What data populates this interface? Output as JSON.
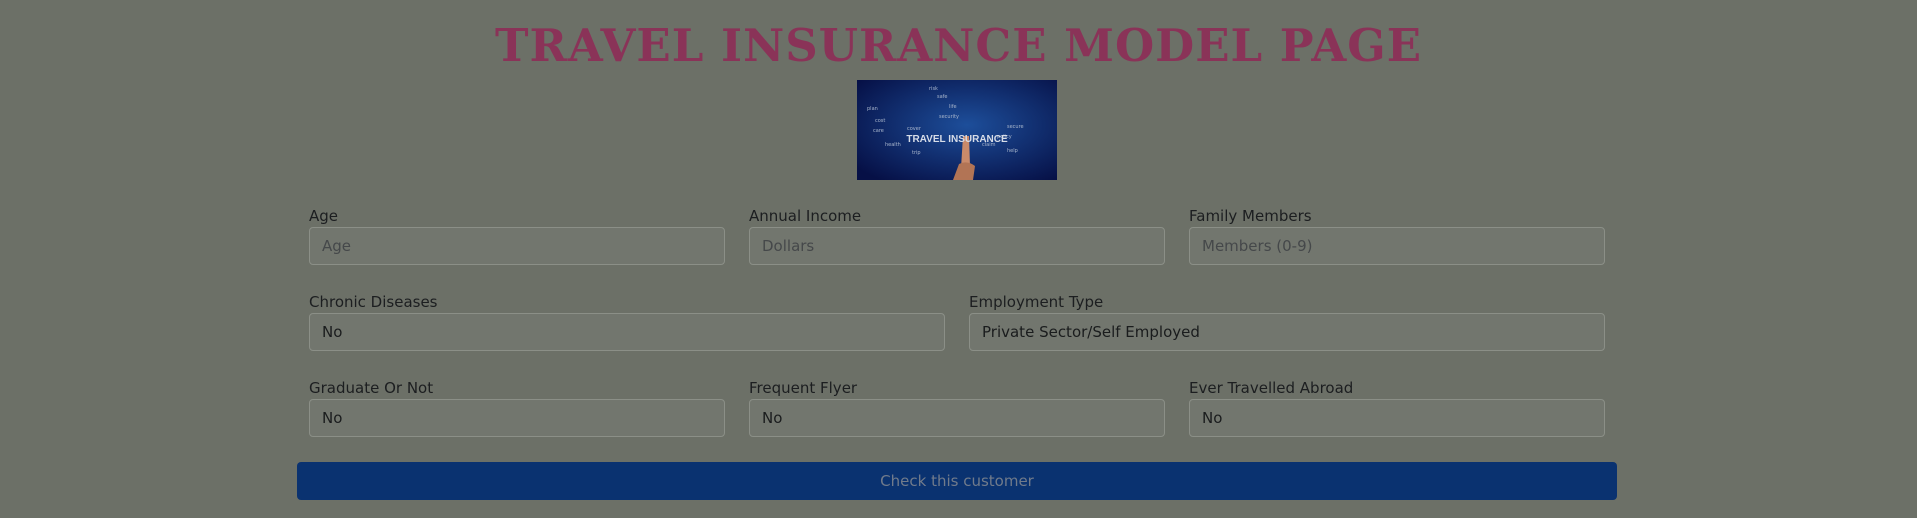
{
  "page": {
    "title": "TRAVEL INSURANCE MODEL PAGE",
    "hero_image": {
      "icon": "travel-insurance-banner",
      "text": "TRAVEL INSURANCE",
      "colors": {
        "bg_dark": "#061046",
        "bg_light": "#1d4e9a",
        "text": "#d7dde8"
      }
    }
  },
  "form": {
    "age": {
      "label": "Age",
      "placeholder": "Age",
      "value": ""
    },
    "annual_income": {
      "label": "Annual Income",
      "placeholder": "Dollars",
      "value": ""
    },
    "family_members": {
      "label": "Family Members",
      "placeholder": "Members (0-9)",
      "value": ""
    },
    "chronic_diseases": {
      "label": "Chronic Diseases",
      "value": "No"
    },
    "employment_type": {
      "label": "Employment Type",
      "value": "Private Sector/Self Employed"
    },
    "graduate_or_not": {
      "label": "Graduate Or Not",
      "value": "No"
    },
    "frequent_flyer": {
      "label": "Frequent Flyer",
      "value": "No"
    },
    "ever_travelled_abroad": {
      "label": "Ever Travelled Abroad",
      "value": "No"
    },
    "submit_label": "Check this customer"
  },
  "colors": {
    "overlay_bg": "#6c7067",
    "title": "#8a3358",
    "button_bg": "#0a3270",
    "button_text": "#717b8b"
  }
}
